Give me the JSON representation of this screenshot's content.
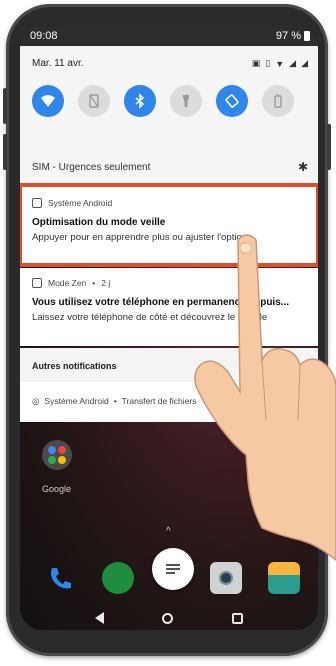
{
  "status_bar": {
    "time": "09:08",
    "battery": "97 %"
  },
  "quick_settings": {
    "date": "Mar. 11 avr.",
    "tiles": [
      {
        "name": "wifi-icon",
        "state": "on"
      },
      {
        "name": "mobile-data-icon",
        "state": "off"
      },
      {
        "name": "bluetooth-icon",
        "state": "on"
      },
      {
        "name": "flashlight-icon",
        "state": "off"
      },
      {
        "name": "auto-rotate-icon",
        "state": "on"
      },
      {
        "name": "battery-saver-icon",
        "state": "off"
      }
    ],
    "sim_label": "SIM - Urgences seulement",
    "accent_color": "#2f86e8"
  },
  "notifications": [
    {
      "app": "Système Android",
      "title": "Optimisation du mode veille",
      "text": "Appuyer pour en apprendre plus ou ajuster l'option"
    },
    {
      "app": "Mode Zen",
      "time": "2 j",
      "title": "Vous utilisez votre téléphone en permanence depuis...",
      "text": "Laissez votre téléphone de côté et découvrez le monde"
    }
  ],
  "other_notifications": {
    "header": "Autres notifications",
    "app": "Système Android",
    "text": "Transfert de fichiers"
  },
  "home": {
    "folder_label": "Google"
  },
  "highlight_color": "#e24d2a"
}
